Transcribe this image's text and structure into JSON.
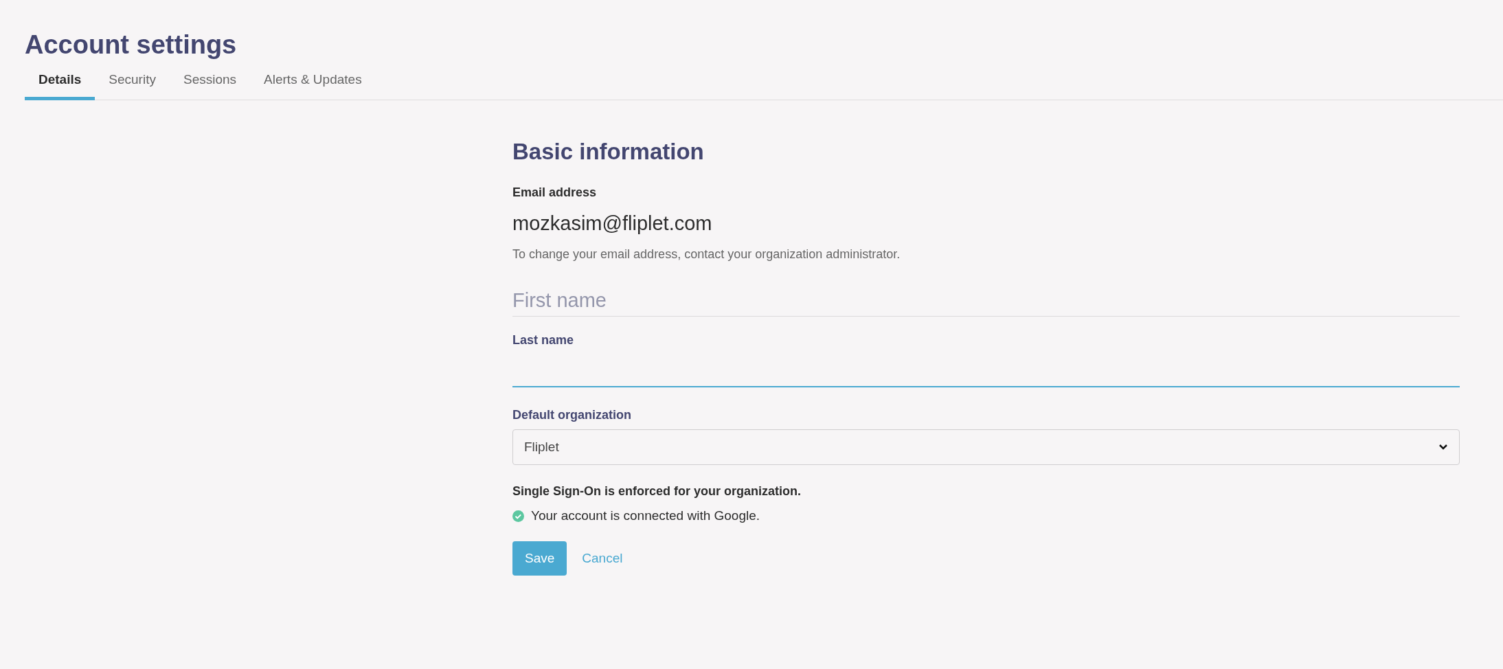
{
  "page": {
    "title": "Account settings"
  },
  "tabs": [
    {
      "label": "Details",
      "selected": true
    },
    {
      "label": "Security",
      "selected": false
    },
    {
      "label": "Sessions",
      "selected": false
    },
    {
      "label": "Alerts & Updates",
      "selected": false
    }
  ],
  "form": {
    "heading": "Basic information",
    "email": {
      "label": "Email address",
      "value": "mozkasim@fliplet.com",
      "help": "To change your email address, contact your organization administrator."
    },
    "first_name": {
      "placeholder": "First name",
      "focused": false
    },
    "last_name": {
      "label": "Last name",
      "focused": true
    },
    "default_organization": {
      "label": "Default organization",
      "value": "Fliplet"
    },
    "sso": {
      "notice": "Single Sign-On is enforced for your organization.",
      "status": "Your account is connected with Google."
    },
    "buttons": {
      "save": "Save",
      "cancel": "Cancel"
    }
  }
}
